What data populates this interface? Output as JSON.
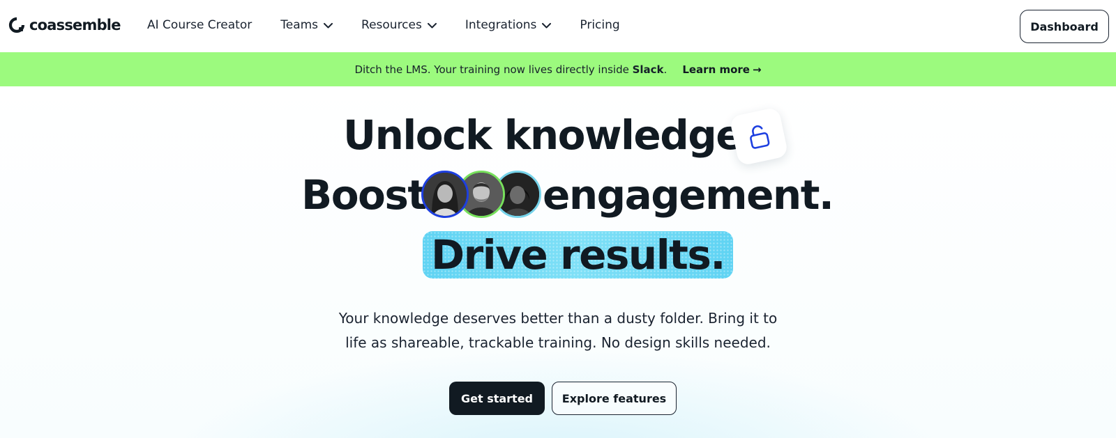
{
  "header": {
    "logo_text": "coassemble",
    "nav": [
      {
        "label": "AI Course Creator",
        "dropdown": false
      },
      {
        "label": "Teams",
        "dropdown": true
      },
      {
        "label": "Resources",
        "dropdown": true
      },
      {
        "label": "Integrations",
        "dropdown": true
      },
      {
        "label": "Pricing",
        "dropdown": false
      }
    ],
    "dashboard_label": "Dashboard"
  },
  "banner": {
    "text_before": "Ditch the LMS. Your training now lives directly inside ",
    "text_bold": "Slack",
    "text_after": ".",
    "link_label": "Learn more",
    "link_arrow": "→",
    "background_color": "#9cfa7e"
  },
  "hero": {
    "line1": "Unlock knowledge",
    "line2_before": "Boost",
    "line2_after": "engagement.",
    "line3": "Drive results.",
    "subcopy_line1": "Your knowledge deserves better than a dusty folder. Bring it to",
    "subcopy_line2": "life as shareable, trackable training. No design skills needed.",
    "cta_primary": "Get started",
    "cta_secondary": "Explore features",
    "lock_icon": "unlock-icon",
    "avatar_ring_colors": [
      "#1d3fe0",
      "#77e05c",
      "#76d3ea"
    ],
    "highlight_color": "#5fd3f3"
  }
}
